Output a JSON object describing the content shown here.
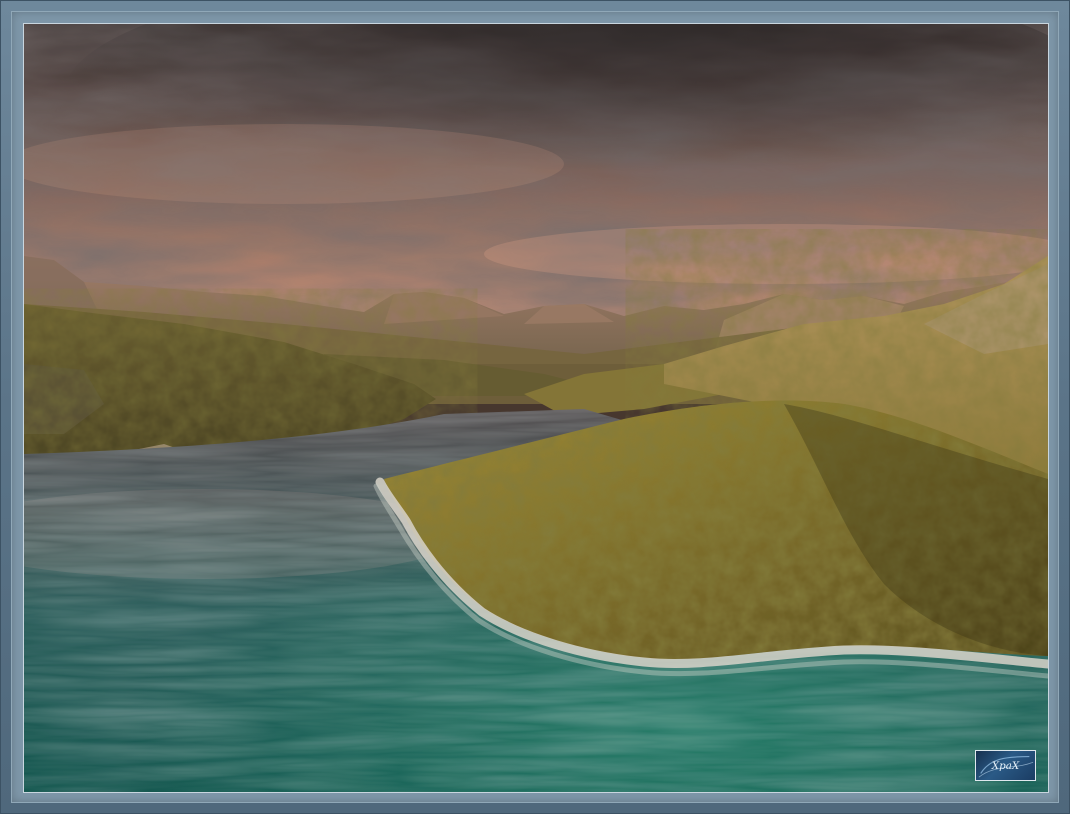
{
  "image": {
    "scene": "aerial-coastal-landscape",
    "colors": {
      "frame": "#5f7a90",
      "sky_warm": "#c98c72",
      "sky_dark": "#4e4240",
      "water_teal": "#1f6e62",
      "hill_olive": "#8a7a2e"
    },
    "watermark": {
      "icon": "xpax-logo-icon",
      "text": "XpaX"
    }
  }
}
